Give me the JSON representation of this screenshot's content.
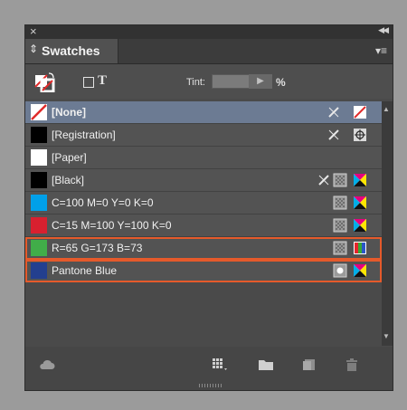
{
  "panel": {
    "title": "Swatches"
  },
  "toolbar": {
    "tint_label": "Tint:",
    "tint_value": "",
    "tint_unit": "%"
  },
  "swatches": [
    {
      "name": "[None]",
      "color": "none"
    },
    {
      "name": "[Registration]",
      "color": "#000000"
    },
    {
      "name": "[Paper]",
      "color": "#ffffff"
    },
    {
      "name": "[Black]",
      "color": "#000000"
    },
    {
      "name": "C=100 M=0 Y=0 K=0",
      "color": "#00a0e9"
    },
    {
      "name": "C=15 M=100 Y=100 K=0",
      "color": "#d8202f"
    },
    {
      "name": "R=65 G=173 B=73",
      "color": "#41ad49"
    },
    {
      "name": "Pantone Blue",
      "color": "#233f8f"
    }
  ],
  "icons": {
    "close": "close-icon",
    "collapse": "double-chevron-left-icon",
    "panel_menu": "panel-menu-icon",
    "non_editable": "no-edit-pencil-icon",
    "process_type": "process-color-icon",
    "spot_type": "spot-color-icon",
    "cmyk_mode": "cmyk-mode-icon",
    "rgb_mode": "rgb-mode-icon",
    "none_mode": "none-mode-icon",
    "registration_mode": "registration-mode-icon",
    "cloud": "cloud-icon",
    "view_options": "swatch-view-options-icon",
    "new_group": "folder-icon",
    "new_swatch": "new-swatch-icon",
    "delete": "trash-icon"
  },
  "colors": {
    "selection": "#6c7b93",
    "highlight_outline": "#e55a2b",
    "panel_bg": "#4a4a4a"
  }
}
